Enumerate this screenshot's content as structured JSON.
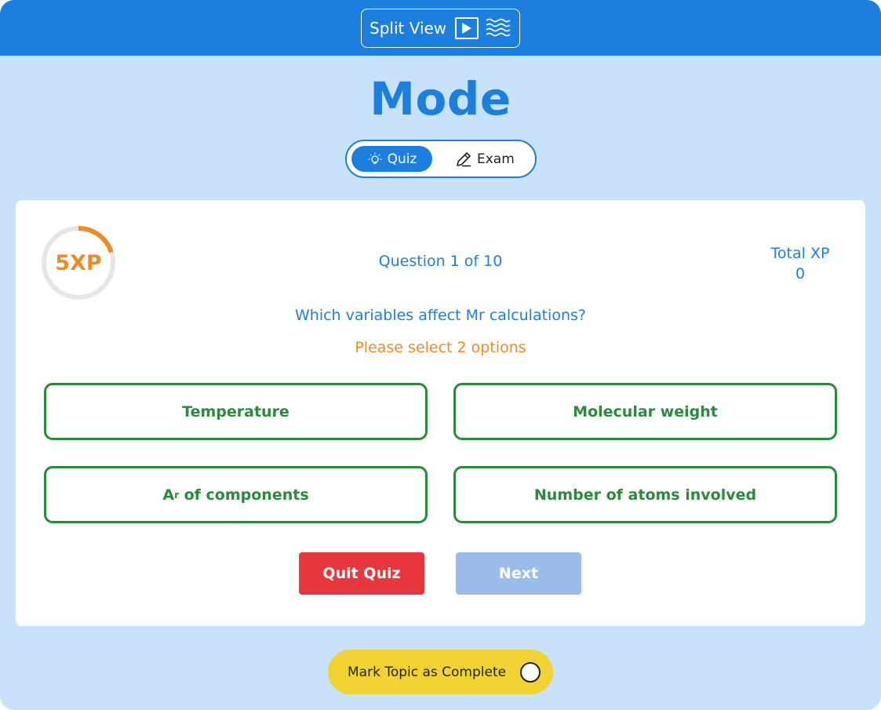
{
  "topbar": {
    "split_view_label": "Split View",
    "icons": [
      "play-icon",
      "waves-icon"
    ]
  },
  "mode": {
    "title": "Mode",
    "tabs": [
      {
        "label": "Quiz",
        "icon": "lightbulb-icon",
        "active": true
      },
      {
        "label": "Exam",
        "icon": "pencil-icon",
        "active": false
      }
    ]
  },
  "quiz": {
    "xp_badge": "5XP",
    "xp_timer_fraction": 0.2,
    "question_counter": "Question 1 of 10",
    "total_xp_label": "Total XP",
    "total_xp_value": "0",
    "question": "Which variables affect Mr calculations?",
    "instruction": "Please select 2 options",
    "options": [
      {
        "label": "Temperature"
      },
      {
        "label": "Molecular weight"
      },
      {
        "label_main": "A",
        "label_sub": "r",
        "label_rest": " of components"
      },
      {
        "label": "Number of atoms involved"
      }
    ],
    "quit_label": "Quit Quiz",
    "next_label": "Next"
  },
  "footer": {
    "mark_complete_label": "Mark Topic as Complete"
  },
  "colors": {
    "primary": "#1c7fdd",
    "background": "#c9e2fb",
    "accent_orange": "#f08a24",
    "option_green": "#2c8a3c",
    "quit_red": "#e5373d",
    "next_disabled": "#9bbbeb",
    "complete_yellow": "#f0d232"
  }
}
